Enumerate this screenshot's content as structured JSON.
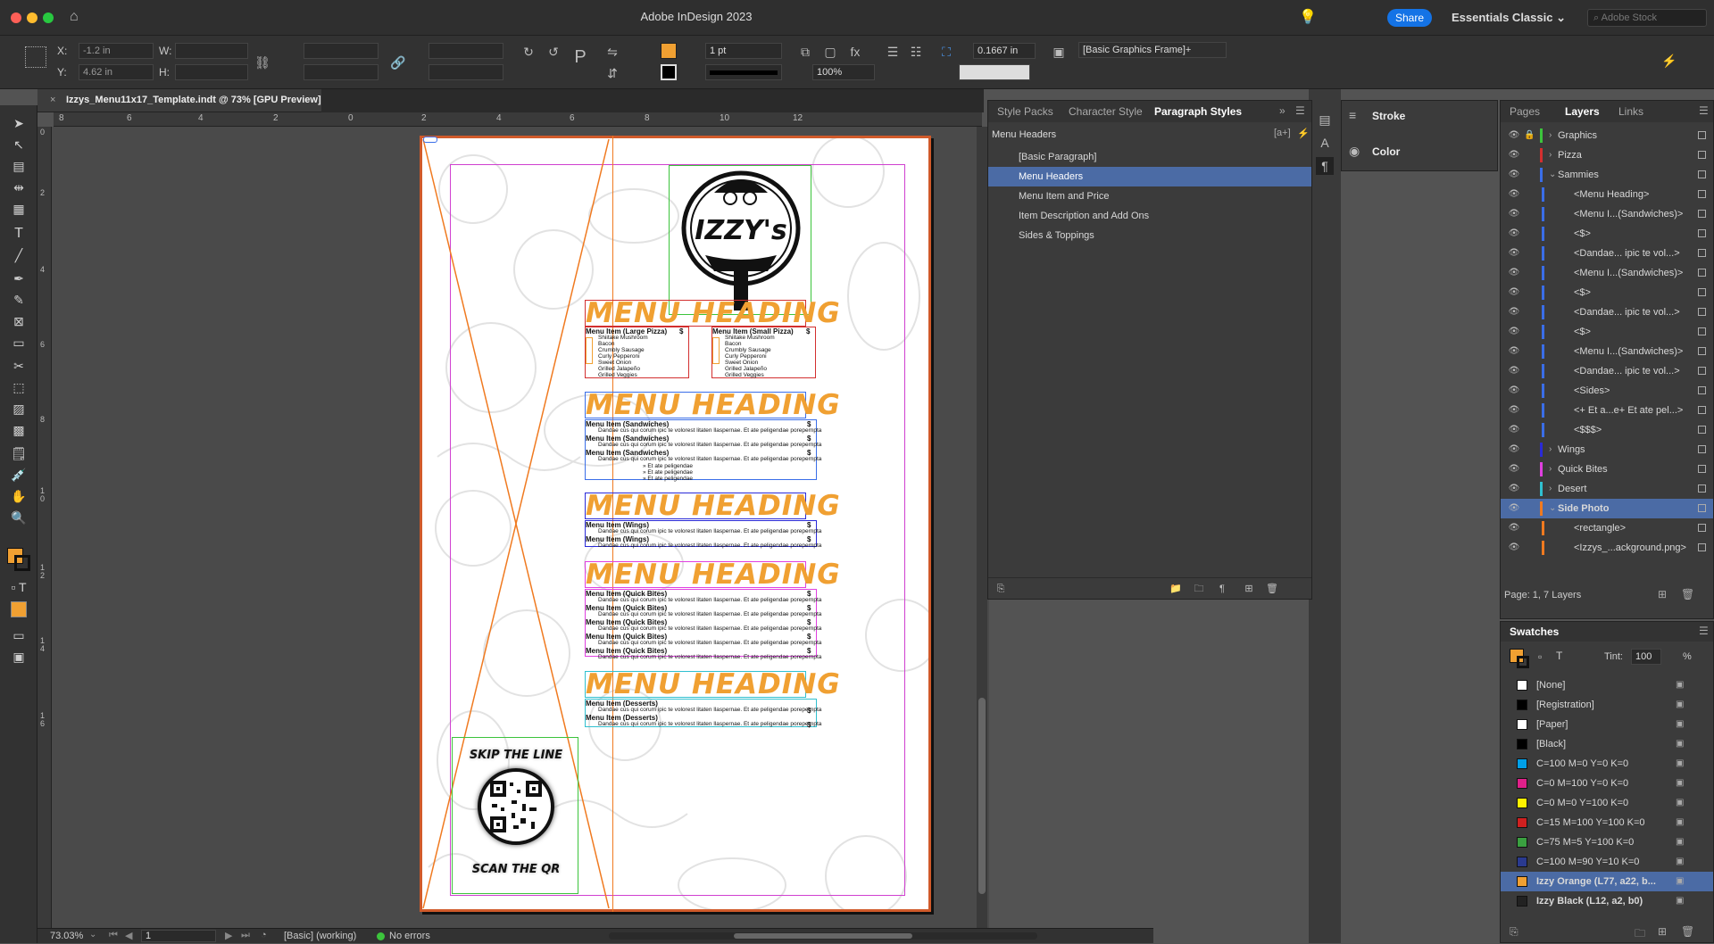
{
  "app": {
    "title": "Adobe InDesign 2023",
    "share": "Share",
    "workspace": "Essentials Classic",
    "search_placeholder": "Adobe Stock"
  },
  "control": {
    "x_label": "X:",
    "x": "-1.2 in",
    "y_label": "Y:",
    "y": "4.62 in",
    "w_label": "W:",
    "h_label": "H:",
    "stroke_weight": "1 pt",
    "zoom": "100%",
    "ref_value": "0.1667 in",
    "object_style": "[Basic Graphics Frame]+"
  },
  "document": {
    "tab": "Izzys_Menu11x17_Template.indt @ 73% [GPU Preview]",
    "ruler_h": [
      "8",
      "6",
      "4",
      "2",
      "0",
      "2",
      "4",
      "6",
      "8",
      "10",
      "12"
    ],
    "ruler_v": [
      "0",
      "2",
      "4",
      "6",
      "8",
      "1\n0",
      "1\n2",
      "1\n4",
      "1\n6"
    ]
  },
  "menu": {
    "headings": [
      "MENU HEADING",
      "MENU HEADING",
      "MENU HEADING",
      "MENU HEADING",
      "MENU HEADING"
    ],
    "pizza_large": "Menu Item (Large Pizza)",
    "pizza_small": "Menu Item (Small Pizza)",
    "toppings": [
      "Shiitake Mushroom",
      "Bacon",
      "Crumbly Sausage",
      "Curly Pepperoni",
      "Sweet Onion",
      "Grilled Jalapeño",
      "Grilled Veggies"
    ],
    "sandwiches": "Menu Item (Sandwiches)",
    "wings": "Menu Item (Wings)",
    "quick": "Menu Item (Quick Bites)",
    "desserts": "Menu Item (Desserts)",
    "desc": "Dandae cus qui corum ipic te volorest litaten llaspernae. Et ate peligendae porepernpta",
    "addons": [
      "» Et ate peligendae",
      "» Et ate peligendae",
      "» Et ate peligendae"
    ],
    "price": "$",
    "qr_top": "SKIP THE LINE",
    "qr_bottom": "SCAN THE QR"
  },
  "status": {
    "zoom": "73.03%",
    "page": "1",
    "preflight": "[Basic] (working)",
    "errors": "No errors"
  },
  "paragraph_styles": {
    "tabs": [
      "Style Packs",
      "Character Style",
      "Paragraph Styles"
    ],
    "current": "Menu Headers",
    "items": [
      "[Basic Paragraph]",
      "Menu Headers",
      "Menu Item and Price",
      "Item Description and Add Ons",
      "Sides & Toppings"
    ]
  },
  "stroke_panel": {
    "stroke": "Stroke",
    "color": "Color"
  },
  "layers": {
    "tabs": [
      "Pages",
      "Layers",
      "Links"
    ],
    "items": [
      {
        "name": "Graphics",
        "level": 0,
        "color": "#3cc43c"
      },
      {
        "name": "Pizza",
        "level": 0,
        "color": "#d32f2f"
      },
      {
        "name": "Sammies",
        "level": 0,
        "color": "#3a6ee8"
      },
      {
        "name": "<Menu Heading>",
        "level": 1,
        "color": "#3a6ee8"
      },
      {
        "name": "<Menu I...(Sandwiches)>",
        "level": 1,
        "color": "#3a6ee8"
      },
      {
        "name": "<$>",
        "level": 1,
        "color": "#3a6ee8"
      },
      {
        "name": "<Dandae... ipic te vol...>",
        "level": 1,
        "color": "#3a6ee8"
      },
      {
        "name": "<Menu I...(Sandwiches)>",
        "level": 1,
        "color": "#3a6ee8"
      },
      {
        "name": "<$>",
        "level": 1,
        "color": "#3a6ee8"
      },
      {
        "name": "<Dandae... ipic te vol...>",
        "level": 1,
        "color": "#3a6ee8"
      },
      {
        "name": "<$>",
        "level": 1,
        "color": "#3a6ee8"
      },
      {
        "name": "<Menu I...(Sandwiches)>",
        "level": 1,
        "color": "#3a6ee8"
      },
      {
        "name": "<Dandae... ipic te vol...>",
        "level": 1,
        "color": "#3a6ee8"
      },
      {
        "name": "<Sides>",
        "level": 1,
        "color": "#3a6ee8"
      },
      {
        "name": "<+ Et a...e+ Et ate pel...>",
        "level": 1,
        "color": "#3a6ee8"
      },
      {
        "name": "<$$$>",
        "level": 1,
        "color": "#3a6ee8"
      },
      {
        "name": "Wings",
        "level": 0,
        "color": "#2a2ad8"
      },
      {
        "name": "Quick Bites",
        "level": 0,
        "color": "#e040e0"
      },
      {
        "name": "Desert",
        "level": 0,
        "color": "#30c0d0"
      },
      {
        "name": "Side Photo",
        "level": 0,
        "color": "#f07a20"
      },
      {
        "name": "<rectangle>",
        "level": 1,
        "color": "#f07a20"
      },
      {
        "name": "<Izzys_...ackground.png>",
        "level": 1,
        "color": "#f07a20"
      }
    ],
    "footer": "Page: 1, 7 Layers"
  },
  "swatches": {
    "title": "Swatches",
    "tint_label": "Tint:",
    "tint": "100",
    "pct": "%",
    "items": [
      {
        "name": "[None]",
        "color": "#ffffff"
      },
      {
        "name": "[Registration]",
        "color": "#000000"
      },
      {
        "name": "[Paper]",
        "color": "#ffffff"
      },
      {
        "name": "[Black]",
        "color": "#000000"
      },
      {
        "name": "C=100 M=0 Y=0 K=0",
        "color": "#00a0e8"
      },
      {
        "name": "C=0 M=100 Y=0 K=0",
        "color": "#e0208a"
      },
      {
        "name": "C=0 M=0 Y=100 K=0",
        "color": "#fff200"
      },
      {
        "name": "C=15 M=100 Y=100 K=0",
        "color": "#d02020"
      },
      {
        "name": "C=75 M=5 Y=100 K=0",
        "color": "#3aa040"
      },
      {
        "name": "C=100 M=90 Y=10 K=0",
        "color": "#2a3a90"
      },
      {
        "name": "Izzy Orange (L77, a22, b...",
        "color": "#f0a032"
      },
      {
        "name": "Izzy Black (L12, a2, b0)",
        "color": "#222222"
      }
    ]
  }
}
